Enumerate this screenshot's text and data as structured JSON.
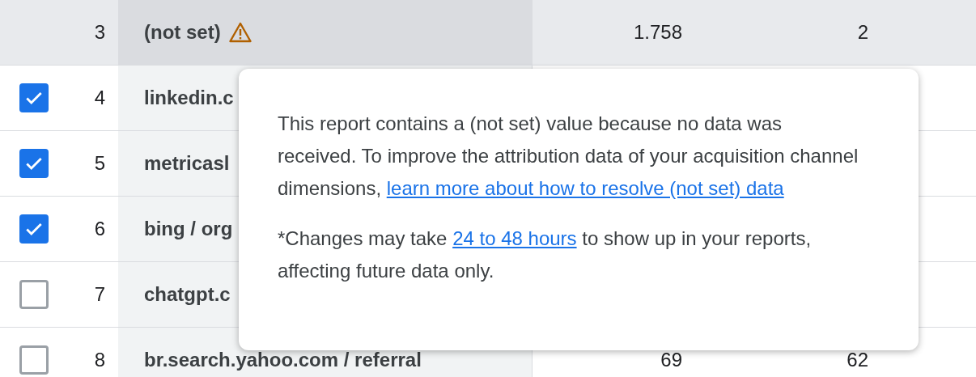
{
  "rows": [
    {
      "index": "3",
      "name": "(not set)",
      "warning": true,
      "highlighted": true,
      "col_3": "1.758",
      "col_4": "2"
    },
    {
      "index": "4",
      "name": "linkedin.c",
      "checked": true,
      "warning": false,
      "highlighted": false
    },
    {
      "index": "5",
      "name": "metricasl",
      "checked": true,
      "warning": false,
      "highlighted": false
    },
    {
      "index": "6",
      "name": "bing / org",
      "checked": true,
      "warning": false,
      "highlighted": false
    },
    {
      "index": "7",
      "name": "chatgpt.c",
      "checked": false,
      "warning": false,
      "highlighted": false
    },
    {
      "index": "8",
      "name": "br.search.yahoo.com / referral",
      "checked": false,
      "warning": false,
      "highlighted": false,
      "col_3": "69",
      "col_4": "62"
    }
  ],
  "tooltip": {
    "paragraphs": [
      {
        "text": "This report contains a (not set) value because no data was received. To improve the attribution data of your acquisition channel dimensions,",
        "link": "learn more about how to resolve (not set) data"
      },
      {
        "text": "*Changes may take",
        "link": "24 to 48 hours",
        "after": "to show up in your reports, affecting future data only."
      }
    ]
  }
}
